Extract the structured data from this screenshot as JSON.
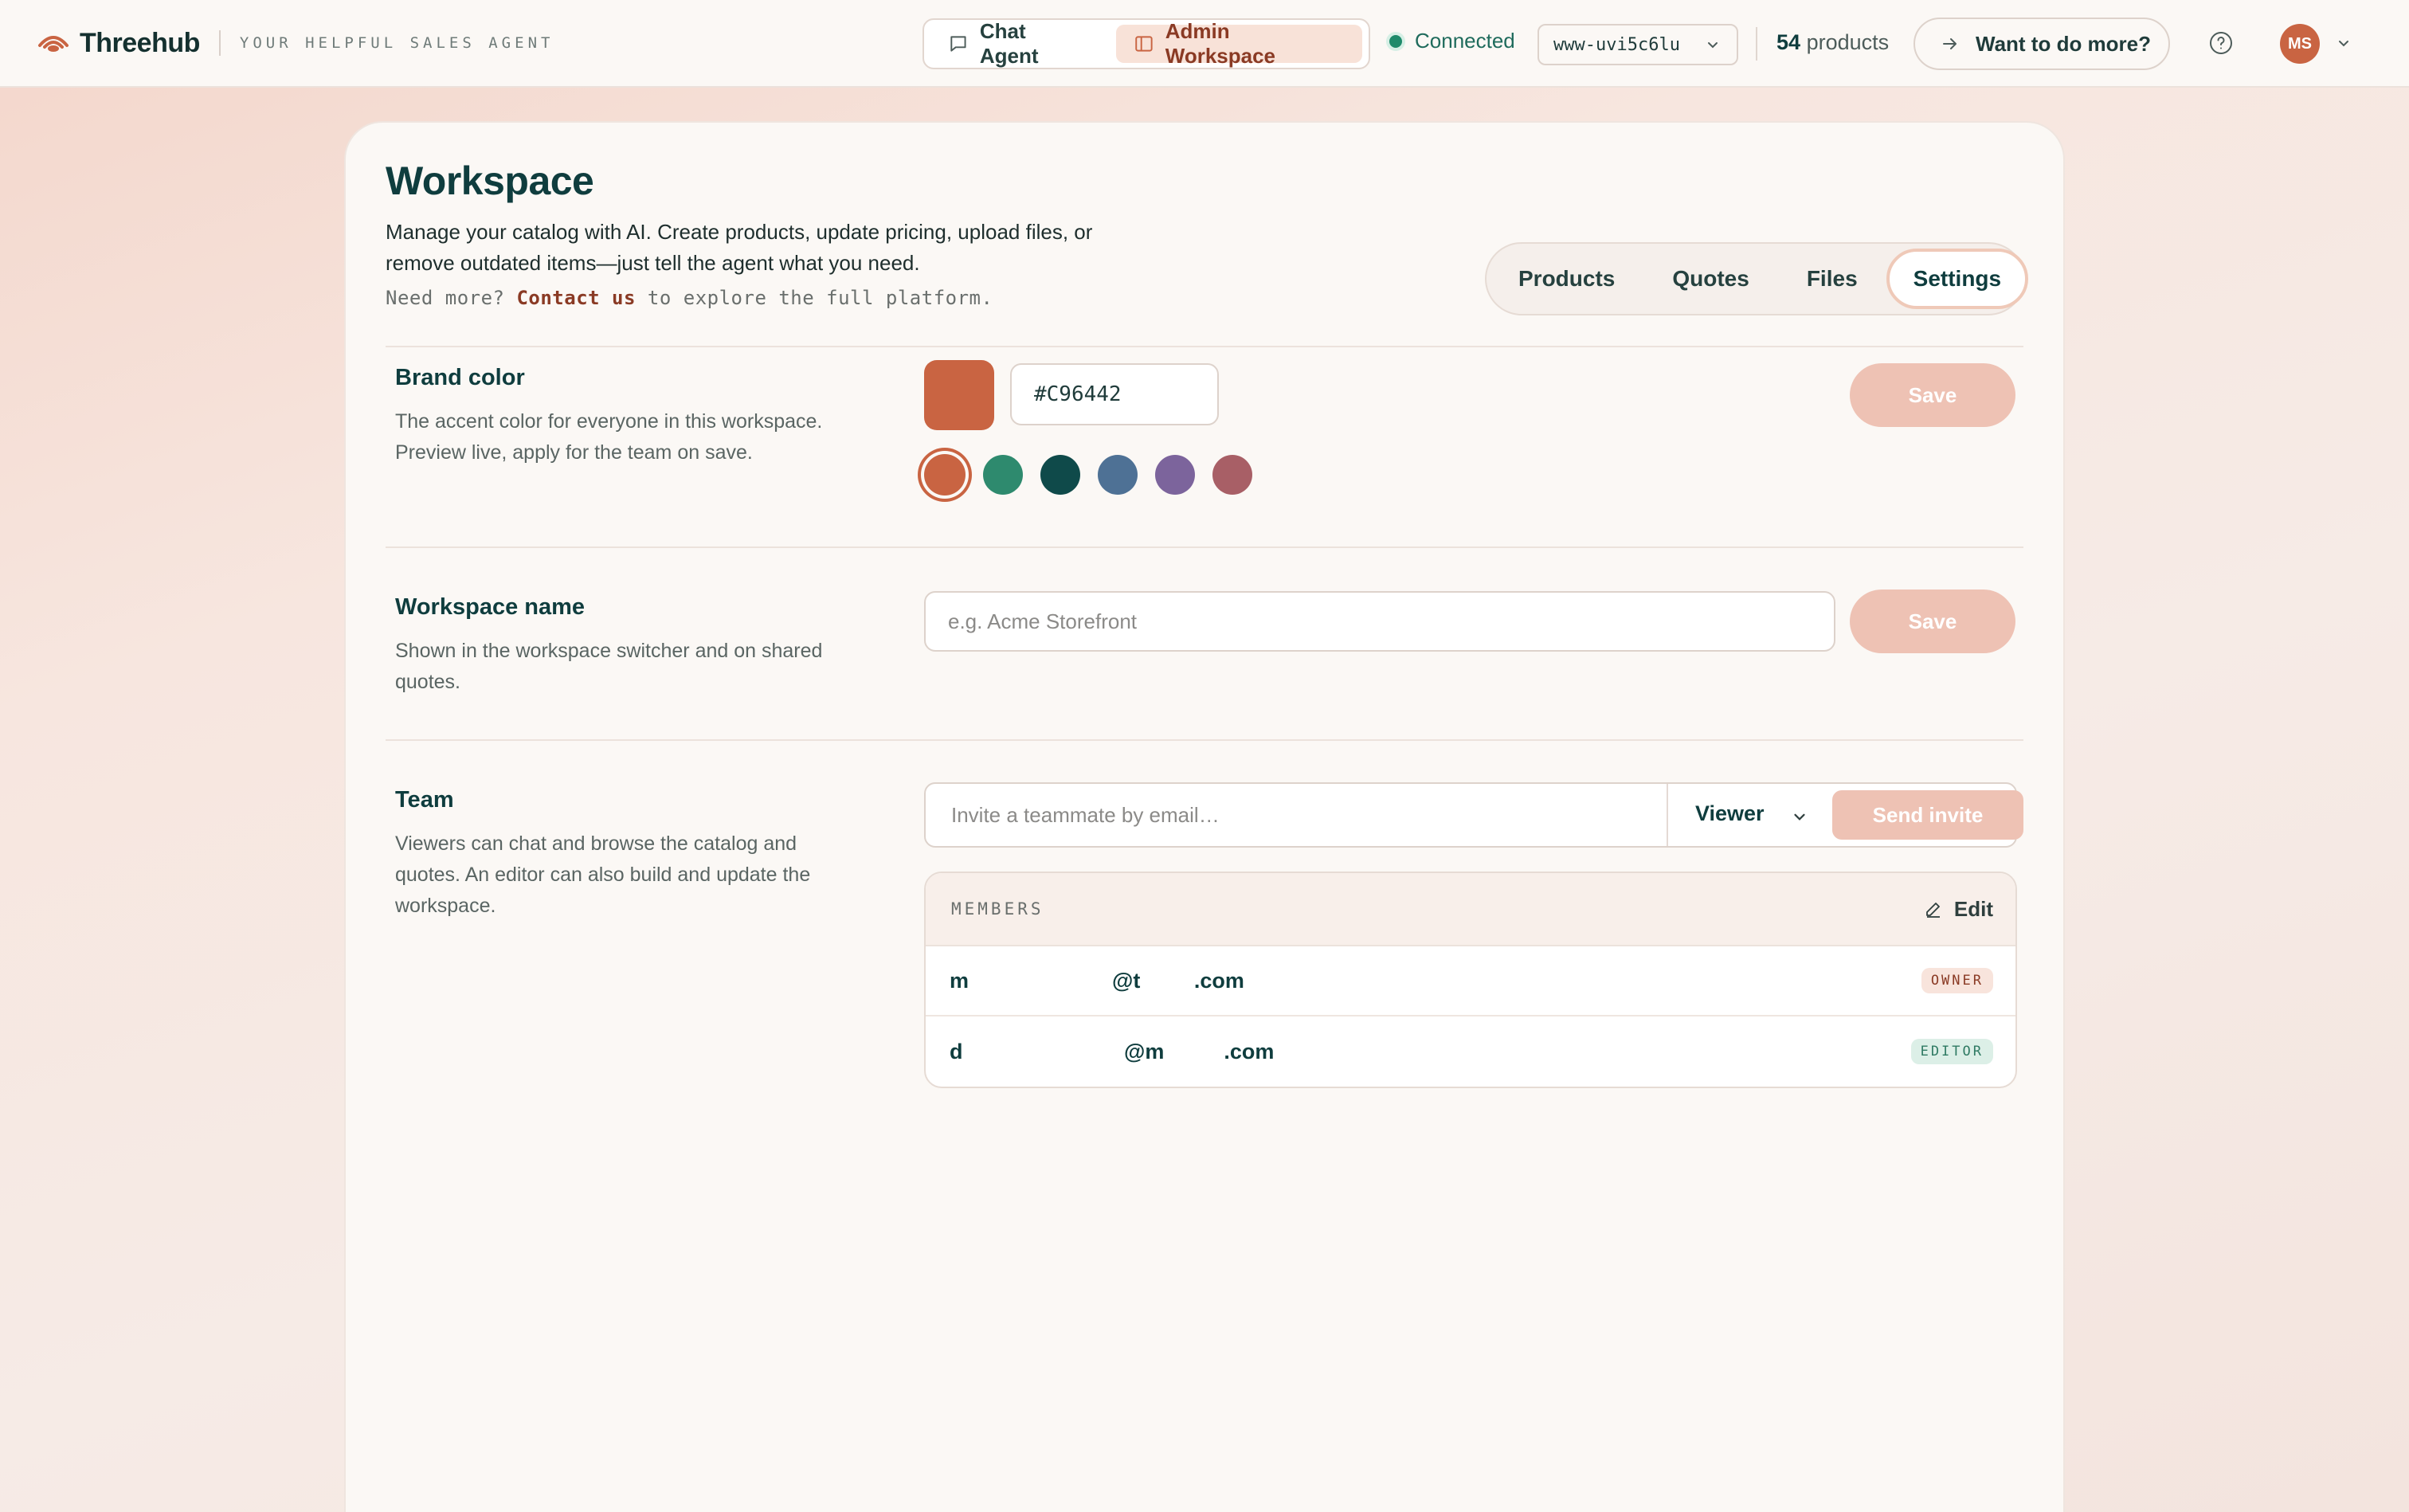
{
  "header": {
    "brand_name": "Threehub",
    "tagline": "YOUR HELPFUL SALES AGENT",
    "modes": [
      {
        "label": "Chat Agent",
        "icon": "chat-bubble-icon",
        "active": false
      },
      {
        "label": "Admin Workspace",
        "icon": "panel-icon",
        "active": true
      }
    ],
    "status_label": "Connected",
    "status_color": "#1e8a6a",
    "workspace_id": "www-uvi5c6lu",
    "product_count": "54",
    "product_count_label": "products",
    "more_label": "Want to do more?",
    "avatar_initials": "MS"
  },
  "page": {
    "title": "Workspace",
    "description": "Manage your catalog with AI. Create products, update pricing, upload files, or remove outdated items—just tell the agent what you need.",
    "cta_prefix": "Need more?",
    "cta_link": "Contact us",
    "cta_suffix": "to explore the full platform.",
    "tabs": [
      {
        "label": "Products",
        "active": false
      },
      {
        "label": "Quotes",
        "active": false
      },
      {
        "label": "Files",
        "active": false
      },
      {
        "label": "Settings",
        "active": true
      }
    ]
  },
  "brand_color": {
    "title": "Brand color",
    "description": "The accent color for everyone in this workspace. Preview live, apply for the team on save.",
    "value": "#C96442",
    "presets": [
      "#c96442",
      "#2e8a6e",
      "#0f4a4a",
      "#4e7195",
      "#7c649c",
      "#a85f66"
    ],
    "save_label": "Save"
  },
  "workspace_name": {
    "title": "Workspace name",
    "description": "Shown in the workspace switcher and on shared quotes.",
    "placeholder": "e.g. Acme Storefront",
    "value": "",
    "save_label": "Save"
  },
  "team": {
    "title": "Team",
    "description": "Viewers can chat and browse the catalog and quotes. An editor can also build and update the workspace.",
    "invite_placeholder": "Invite a teammate by email…",
    "role_selected": "Viewer",
    "invite_label": "Send invite",
    "members_label": "MEMBERS",
    "edit_label": "Edit",
    "members": [
      {
        "email": "m                        @t         .com",
        "role": "OWNER"
      },
      {
        "email": "d                           @m          .com",
        "role": "EDITOR"
      }
    ]
  },
  "colors": {
    "accent": "#c96442",
    "primary_text": "#0f3d3e",
    "save_disabled": "#eec2b4"
  }
}
